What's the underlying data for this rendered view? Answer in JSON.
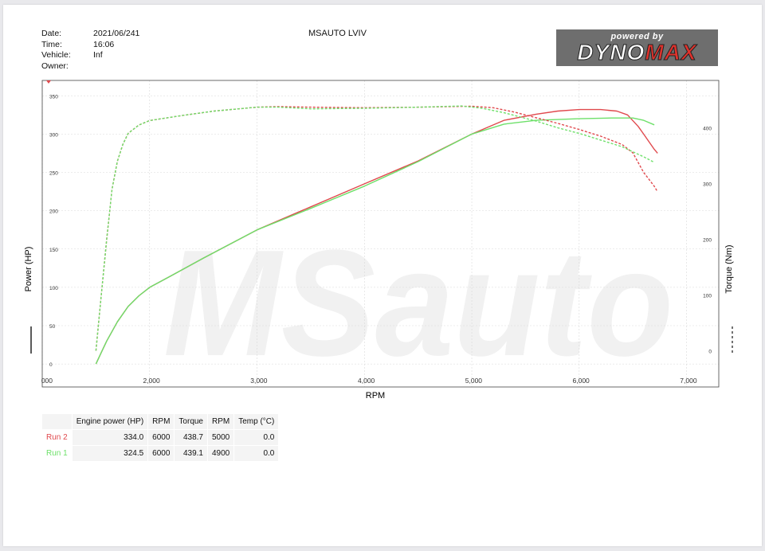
{
  "header": {
    "labels": [
      "Date:",
      "Time:",
      "Vehicle:",
      "Owner:"
    ],
    "values": [
      "2021/06/241",
      "16:06",
      "Inf",
      ""
    ],
    "shop_name": "MSAUTO LVIV"
  },
  "logo": {
    "powered": "powered by",
    "brand_a": "DYNO",
    "brand_b": "MAX"
  },
  "watermark": "MSauto",
  "colors": {
    "run2": "#e0494d",
    "run1": "#6ee06a",
    "grid": "#d9d9d9",
    "watermark": "#f1f1f1"
  },
  "chart_data": {
    "type": "line",
    "xlabel": "RPM",
    "ylabel_left": "Power (HP)",
    "ylabel_right": "Torque (Nm)",
    "xlim": [
      1000,
      7300
    ],
    "ylim_left": [
      -30,
      370
    ],
    "ylim_right": [
      -65,
      485
    ],
    "x_ticks": [
      1000,
      2000,
      3000,
      4000,
      5000,
      6000,
      7000
    ],
    "x_tick_labels": [
      "000",
      "2,000",
      "3,000",
      "4,000",
      "5,000",
      "6,000",
      "7,000"
    ],
    "y_ticks_left": [
      0,
      50,
      100,
      150,
      200,
      250,
      300,
      350
    ],
    "y_tick_labels_left": [
      "0",
      "50",
      "100",
      "150",
      "200",
      "250",
      "300",
      "350"
    ],
    "y_ticks_right": [
      0,
      100,
      200,
      300,
      400
    ],
    "y_tick_labels_right": [
      "0",
      "100",
      "200",
      "300",
      "400"
    ],
    "grid": true,
    "series": [
      {
        "name": "Run 2",
        "quantity": "power",
        "axis": "left",
        "style": "solid",
        "color": "#e0494d",
        "x": [
          1500,
          1550,
          1600,
          1700,
          1800,
          1900,
          2000,
          2200,
          2500,
          3000,
          3500,
          4000,
          4500,
          5000,
          5300,
          5600,
          5800,
          6000,
          6200,
          6350,
          6450,
          6550,
          6600,
          6650,
          6700,
          6730
        ],
        "y": [
          0,
          15,
          30,
          55,
          75,
          89,
          100,
          115,
          138,
          175,
          205,
          235,
          265,
          300,
          318,
          326,
          330,
          332,
          332,
          330,
          325,
          310,
          300,
          290,
          280,
          275
        ]
      },
      {
        "name": "Run 1",
        "quantity": "power",
        "axis": "left",
        "style": "solid",
        "color": "#6ee06a",
        "x": [
          1500,
          1550,
          1600,
          1700,
          1800,
          1900,
          2000,
          2200,
          2500,
          3000,
          3500,
          4000,
          4500,
          5000,
          5300,
          5600,
          5800,
          6000,
          6300,
          6500,
          6600,
          6700
        ],
        "y": [
          0,
          15,
          30,
          55,
          75,
          89,
          100,
          115,
          138,
          175,
          203,
          232,
          264,
          300,
          313,
          318,
          319,
          320,
          321,
          321,
          318,
          312
        ]
      },
      {
        "name": "Run 2",
        "quantity": "torque",
        "axis": "right",
        "style": "dashed",
        "color": "#e0494d",
        "x": [
          1500,
          1550,
          1600,
          1650,
          1700,
          1750,
          1800,
          1900,
          2000,
          2300,
          2600,
          3000,
          3200,
          3500,
          4000,
          4500,
          4800,
          5000,
          5200,
          5400,
          5600,
          5800,
          6000,
          6200,
          6400,
          6500,
          6600,
          6700,
          6730
        ],
        "y": [
          0,
          100,
          200,
          290,
          340,
          370,
          390,
          405,
          413,
          422,
          430,
          437,
          438,
          437,
          436,
          437,
          438,
          438.7,
          436,
          428,
          418,
          408,
          397,
          385,
          370,
          355,
          320,
          295,
          285
        ]
      },
      {
        "name": "Run 1",
        "quantity": "torque",
        "axis": "right",
        "style": "dashed",
        "color": "#6ee06a",
        "x": [
          1500,
          1550,
          1600,
          1650,
          1700,
          1750,
          1800,
          1900,
          2000,
          2300,
          2600,
          3000,
          3200,
          3500,
          4000,
          4500,
          4900,
          5100,
          5300,
          5600,
          5800,
          6000,
          6200,
          6400,
          6600,
          6700
        ],
        "y": [
          0,
          100,
          200,
          290,
          340,
          370,
          390,
          405,
          413,
          422,
          430,
          437,
          437,
          434,
          435,
          437,
          439.1,
          435,
          427,
          412,
          400,
          390,
          378,
          366,
          348,
          338
        ]
      }
    ]
  },
  "results": {
    "headers": [
      "Engine power (HP)",
      "RPM",
      "Torque",
      "RPM",
      "Temp (°C)"
    ],
    "rows": [
      {
        "name": "Run 2",
        "power": "334.0",
        "power_rpm": "6000",
        "torque": "438.7",
        "torque_rpm": "5000",
        "temp": "0.0",
        "color": "#e0494d"
      },
      {
        "name": "Run 1",
        "power": "324.5",
        "power_rpm": "6000",
        "torque": "439.1",
        "torque_rpm": "4900",
        "temp": "0.0",
        "color": "#6ee06a"
      }
    ]
  }
}
